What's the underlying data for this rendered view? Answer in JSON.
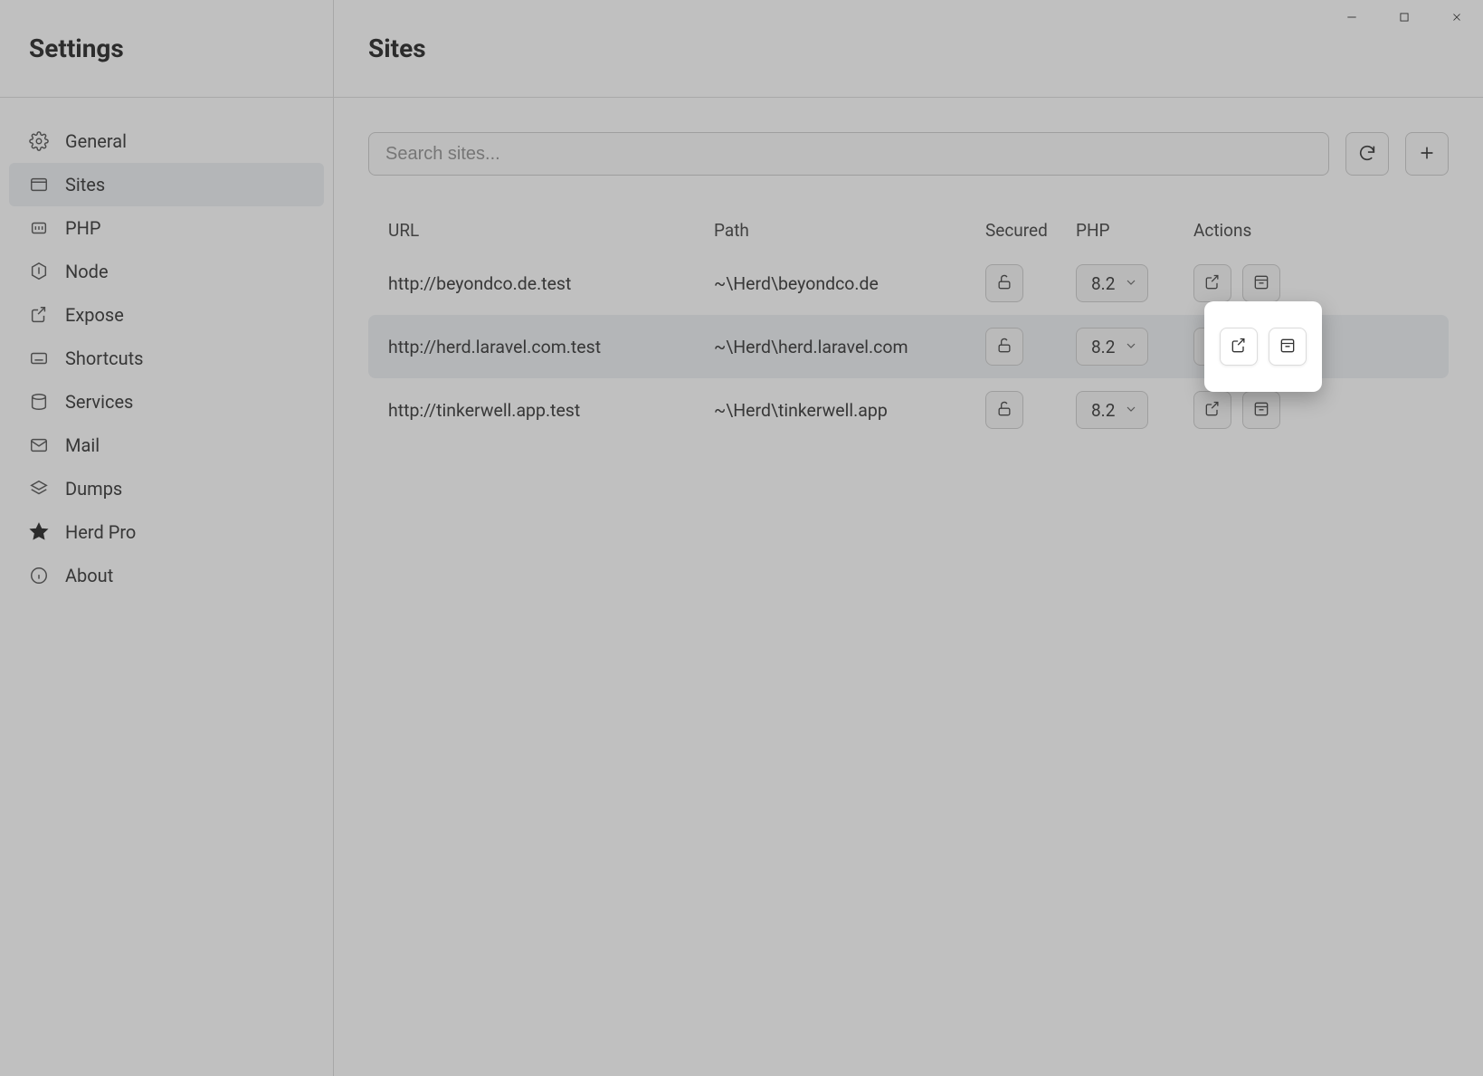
{
  "window": {
    "minimize": "minimize",
    "maximize": "maximize",
    "close": "close"
  },
  "sidebar": {
    "title": "Settings",
    "items": [
      {
        "id": "general",
        "label": "General",
        "icon": "gear-icon"
      },
      {
        "id": "sites",
        "label": "Sites",
        "icon": "browser-icon",
        "active": true
      },
      {
        "id": "php",
        "label": "PHP",
        "icon": "php-icon"
      },
      {
        "id": "node",
        "label": "Node",
        "icon": "node-icon"
      },
      {
        "id": "expose",
        "label": "Expose",
        "icon": "share-icon"
      },
      {
        "id": "shortcuts",
        "label": "Shortcuts",
        "icon": "keyboard-icon"
      },
      {
        "id": "services",
        "label": "Services",
        "icon": "database-icon"
      },
      {
        "id": "mail",
        "label": "Mail",
        "icon": "mail-icon"
      },
      {
        "id": "dumps",
        "label": "Dumps",
        "icon": "layers-icon"
      },
      {
        "id": "herdpro",
        "label": "Herd Pro",
        "icon": "star-icon"
      },
      {
        "id": "about",
        "label": "About",
        "icon": "info-icon"
      }
    ]
  },
  "main": {
    "title": "Sites",
    "search_placeholder": "Search sites...",
    "columns": {
      "url": "URL",
      "path": "Path",
      "secured": "Secured",
      "php": "PHP",
      "actions": "Actions"
    },
    "rows": [
      {
        "url": "http://beyondco.de.test",
        "path": "~\\Herd\\beyondco.de",
        "php": "8.2"
      },
      {
        "url": "http://herd.laravel.com.test",
        "path": "~\\Herd\\herd.laravel.com",
        "php": "8.2",
        "hovered": true
      },
      {
        "url": "http://tinkerwell.app.test",
        "path": "~\\Herd\\tinkerwell.app",
        "php": "8.2"
      }
    ]
  }
}
